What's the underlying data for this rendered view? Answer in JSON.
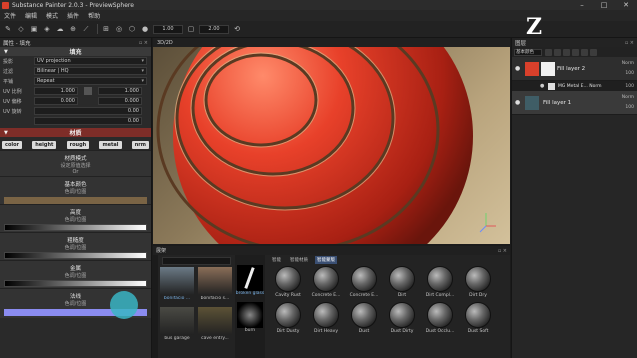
{
  "window": {
    "title": "Substance Painter 2.0.3 - PreviewSphere"
  },
  "menu": [
    "文件",
    "编辑",
    "模式",
    "插件",
    "帮助"
  ],
  "toolbar": {
    "size_value": "1.00",
    "opacity_value": "2.00"
  },
  "left_panel": {
    "header": "属性 - 填充",
    "fill_title": "填充",
    "rows": [
      {
        "label": "投影",
        "value": "UV projection"
      },
      {
        "label": "过滤",
        "value": "Bilinear | HQ"
      },
      {
        "label": "平铺",
        "value": "Repeat"
      }
    ],
    "uv_scale": {
      "label": "UV 比例",
      "v1": "1.000",
      "v2": "1.000"
    },
    "uv_offset": {
      "label": "UV 偏移",
      "v1": "0.000",
      "v2": "0.000"
    },
    "uv_rotate": {
      "label": "UV 旋转",
      "v1": "0.00"
    },
    "extra_value": "0.00",
    "material_title": "材质",
    "channels": [
      "color",
      "height",
      "rough",
      "metal",
      "nrm"
    ],
    "material_mode": {
      "title": "材质模式",
      "sub": "设定原值选择",
      "sub2": "Or"
    },
    "base_color": {
      "title": "基本颜色",
      "sub": "色调/位图",
      "color": "#7a6445"
    },
    "height": {
      "title": "高度",
      "sub": "色调/位图"
    },
    "roughness": {
      "title": "粗糙度",
      "sub": "色调/位图"
    },
    "metallic": {
      "title": "金属",
      "sub": "色调/位图"
    },
    "normal": {
      "title": "法线",
      "sub": "色调/位图",
      "color": "#8b8cf0"
    }
  },
  "viewport": {
    "header": "3D/2D"
  },
  "layers": {
    "header": "图层",
    "blend_mode": "基本颜色",
    "items": [
      {
        "name": "Fill layer 2",
        "blend": "Norm",
        "opacity": "100",
        "thumb_color": "#d9402b"
      },
      {
        "name": "MG Metal E... Norm",
        "opacity": "100",
        "sub": true
      },
      {
        "name": "Fill layer 1",
        "blend": "Norm",
        "opacity": "100",
        "thumb_color": "#3f5d66"
      }
    ]
  },
  "shelf": {
    "header": "展架",
    "tabs": [
      "智能",
      "智能材质",
      "智能蒙版"
    ],
    "active_tab": 2,
    "environments": [
      {
        "name": "bonifacio ...",
        "color": "#6b7a86"
      },
      {
        "name": "bonifacio s...",
        "color": "#8a6e58"
      },
      {
        "name": "bus garage",
        "color": "#4a4a44"
      },
      {
        "name": "cave entry...",
        "color": "#5c5236"
      }
    ],
    "alpha": [
      {
        "name": "broken glass"
      },
      {
        "name": "burn"
      }
    ],
    "materials": [
      "Cavity Rust",
      "Concrete E...",
      "Concrete E...",
      "Dirt",
      "Dirt Compl...",
      "Dirt Dry",
      "Dirt Dusty",
      "Dirt Heavy",
      "Dust",
      "Dust Dirty",
      "Dust Occlu...",
      "Dust Soft"
    ]
  },
  "logo": "Z"
}
